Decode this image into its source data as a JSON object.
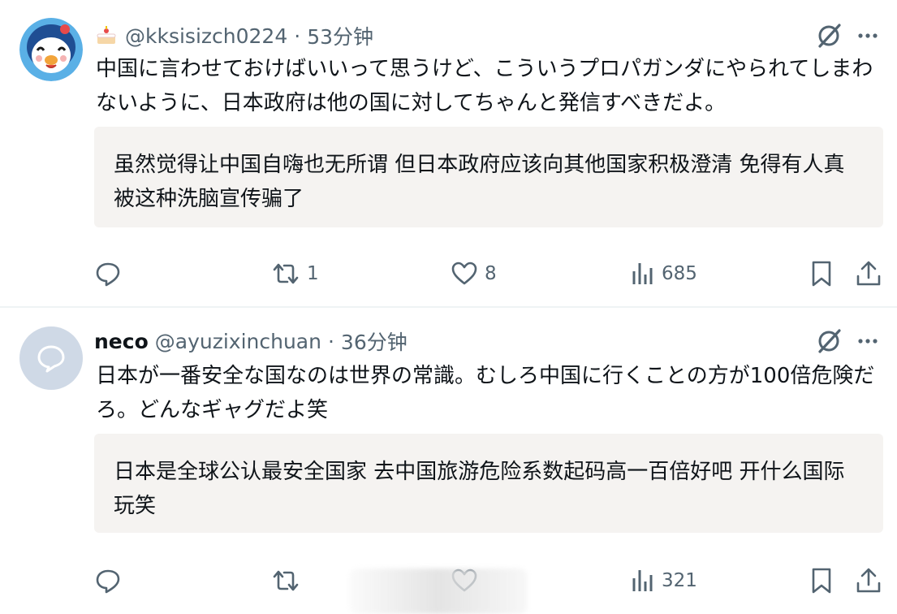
{
  "posts": [
    {
      "badge_emoji": "🍰",
      "handle": "@kksisizch0224",
      "time": "53分钟",
      "separator": "·",
      "text": "中国に言わせておけばいいって思うけど、こういうプロパガンダにやられてしまわないように、日本政府は他の国に対してちゃんと発信すべきだよ。",
      "translation": "虽然觉得让中国自嗨也无所谓 但日本政府应该向其他国家积极澄清 免得有人真被这种洗脑宣传骗了",
      "stats": {
        "reply": "",
        "repost": "1",
        "like": "8",
        "views": "685"
      }
    },
    {
      "display_name": "neco",
      "handle": "@ayuzixinchuan",
      "time": "36分钟",
      "separator": "·",
      "text": "日本が一番安全な国なのは世界の常識。むしろ中国に行くことの方が100倍危険だろ。どんなギャグだよ笑",
      "translation": "日本是全球公认最安全国家 去中国旅游危险系数起码高一百倍好吧 开什么国际玩笑",
      "stats": {
        "reply": "",
        "repost": "",
        "like": "",
        "views": "321"
      }
    }
  ],
  "colors": {
    "text": "#0f1419",
    "secondary": "#536471",
    "translation_bg": "#f5f3f1",
    "divider": "#eff3f4",
    "default_avatar": "#cfd9e6"
  },
  "icons": [
    "penguin-avatar",
    "cake-icon",
    "grok-icon",
    "more-icon",
    "reply-icon",
    "repost-icon",
    "like-icon",
    "views-icon",
    "bookmark-icon",
    "share-icon",
    "default-avatar-icon"
  ]
}
